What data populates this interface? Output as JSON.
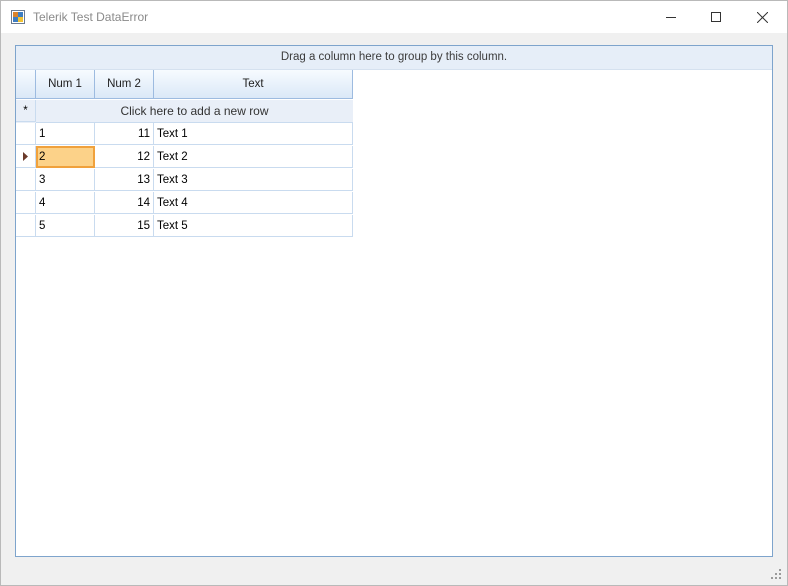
{
  "window": {
    "title": "Telerik Test DataError",
    "controls": {
      "minimize": "minimize",
      "maximize": "maximize",
      "close": "close"
    }
  },
  "grid": {
    "group_panel_text": "Drag a column here to group by this column.",
    "columns": [
      "Num 1",
      "Num 2",
      "Text"
    ],
    "new_row_text": "Click here to add a new row",
    "new_row_marker": "*",
    "rows": [
      {
        "num1": "1",
        "num2": "11",
        "text": "Text 1"
      },
      {
        "num1": "2",
        "num2": "12",
        "text": "Text 2"
      },
      {
        "num1": "3",
        "num2": "13",
        "text": "Text 3"
      },
      {
        "num1": "4",
        "num2": "14",
        "text": "Text 4"
      },
      {
        "num1": "5",
        "num2": "15",
        "text": "Text 5"
      }
    ],
    "current_row_index": 1
  },
  "colors": {
    "grid_border": "#7ea4cc",
    "header_bg": "#dbe8f7",
    "selected_cell_bg": "#fcd289",
    "selected_cell_border": "#f0a13c"
  }
}
